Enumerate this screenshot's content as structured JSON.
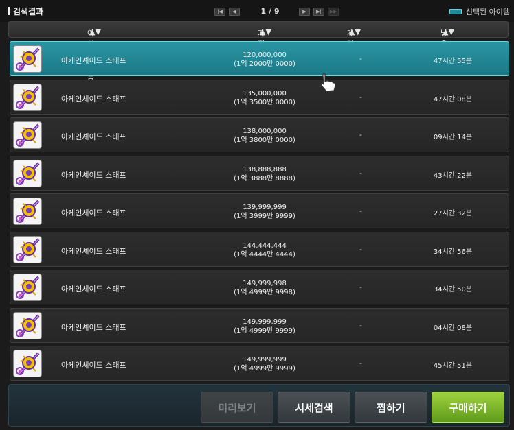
{
  "header": {
    "title": "검색결과",
    "page_current": "1",
    "page_total": "9",
    "legend_label": "선택된 아이템",
    "selected_color": "#1f8d9c"
  },
  "columns": {
    "name": "아이템 이름",
    "price": "가격",
    "unit_price": "개당 가격",
    "remaining": "남은시간"
  },
  "items": [
    {
      "name": "아케인셰이드 스태프",
      "price": "120,000,000",
      "price_kr": "(1억 2000만 0000)",
      "unit_price": "-",
      "remaining": "47시간 55분",
      "selected": true
    },
    {
      "name": "아케인셰이드 스태프",
      "price": "135,000,000",
      "price_kr": "(1억 3500만 0000)",
      "unit_price": "-",
      "remaining": "47시간 08분"
    },
    {
      "name": "아케인셰이드 스태프",
      "price": "138,000,000",
      "price_kr": "(1억 3800만 0000)",
      "unit_price": "-",
      "remaining": "09시간 14분"
    },
    {
      "name": "아케인셰이드 스태프",
      "price": "138,888,888",
      "price_kr": "(1억 3888만 8888)",
      "unit_price": "-",
      "remaining": "43시간 22분"
    },
    {
      "name": "아케인셰이드 스태프",
      "price": "139,999,999",
      "price_kr": "(1억 3999만 9999)",
      "unit_price": "-",
      "remaining": "27시간 32분"
    },
    {
      "name": "아케인셰이드 스태프",
      "price": "144,444,444",
      "price_kr": "(1억 4444만 4444)",
      "unit_price": "-",
      "remaining": "34시간 56분"
    },
    {
      "name": "아케인셰이드 스태프",
      "price": "149,999,998",
      "price_kr": "(1억 4999만 9998)",
      "unit_price": "-",
      "remaining": "34시간 50분"
    },
    {
      "name": "아케인셰이드 스태프",
      "price": "149,999,999",
      "price_kr": "(1억 4999만 9999)",
      "unit_price": "-",
      "remaining": "04시간 08분"
    },
    {
      "name": "아케인셰이드 스태프",
      "price": "149,999,999",
      "price_kr": "(1억 4999만 9999)",
      "unit_price": "-",
      "remaining": "45시간 51분"
    }
  ],
  "buttons": {
    "preview": "미리보기",
    "market_search": "시세검색",
    "wishlist": "찜하기",
    "buy": "구매하기"
  }
}
